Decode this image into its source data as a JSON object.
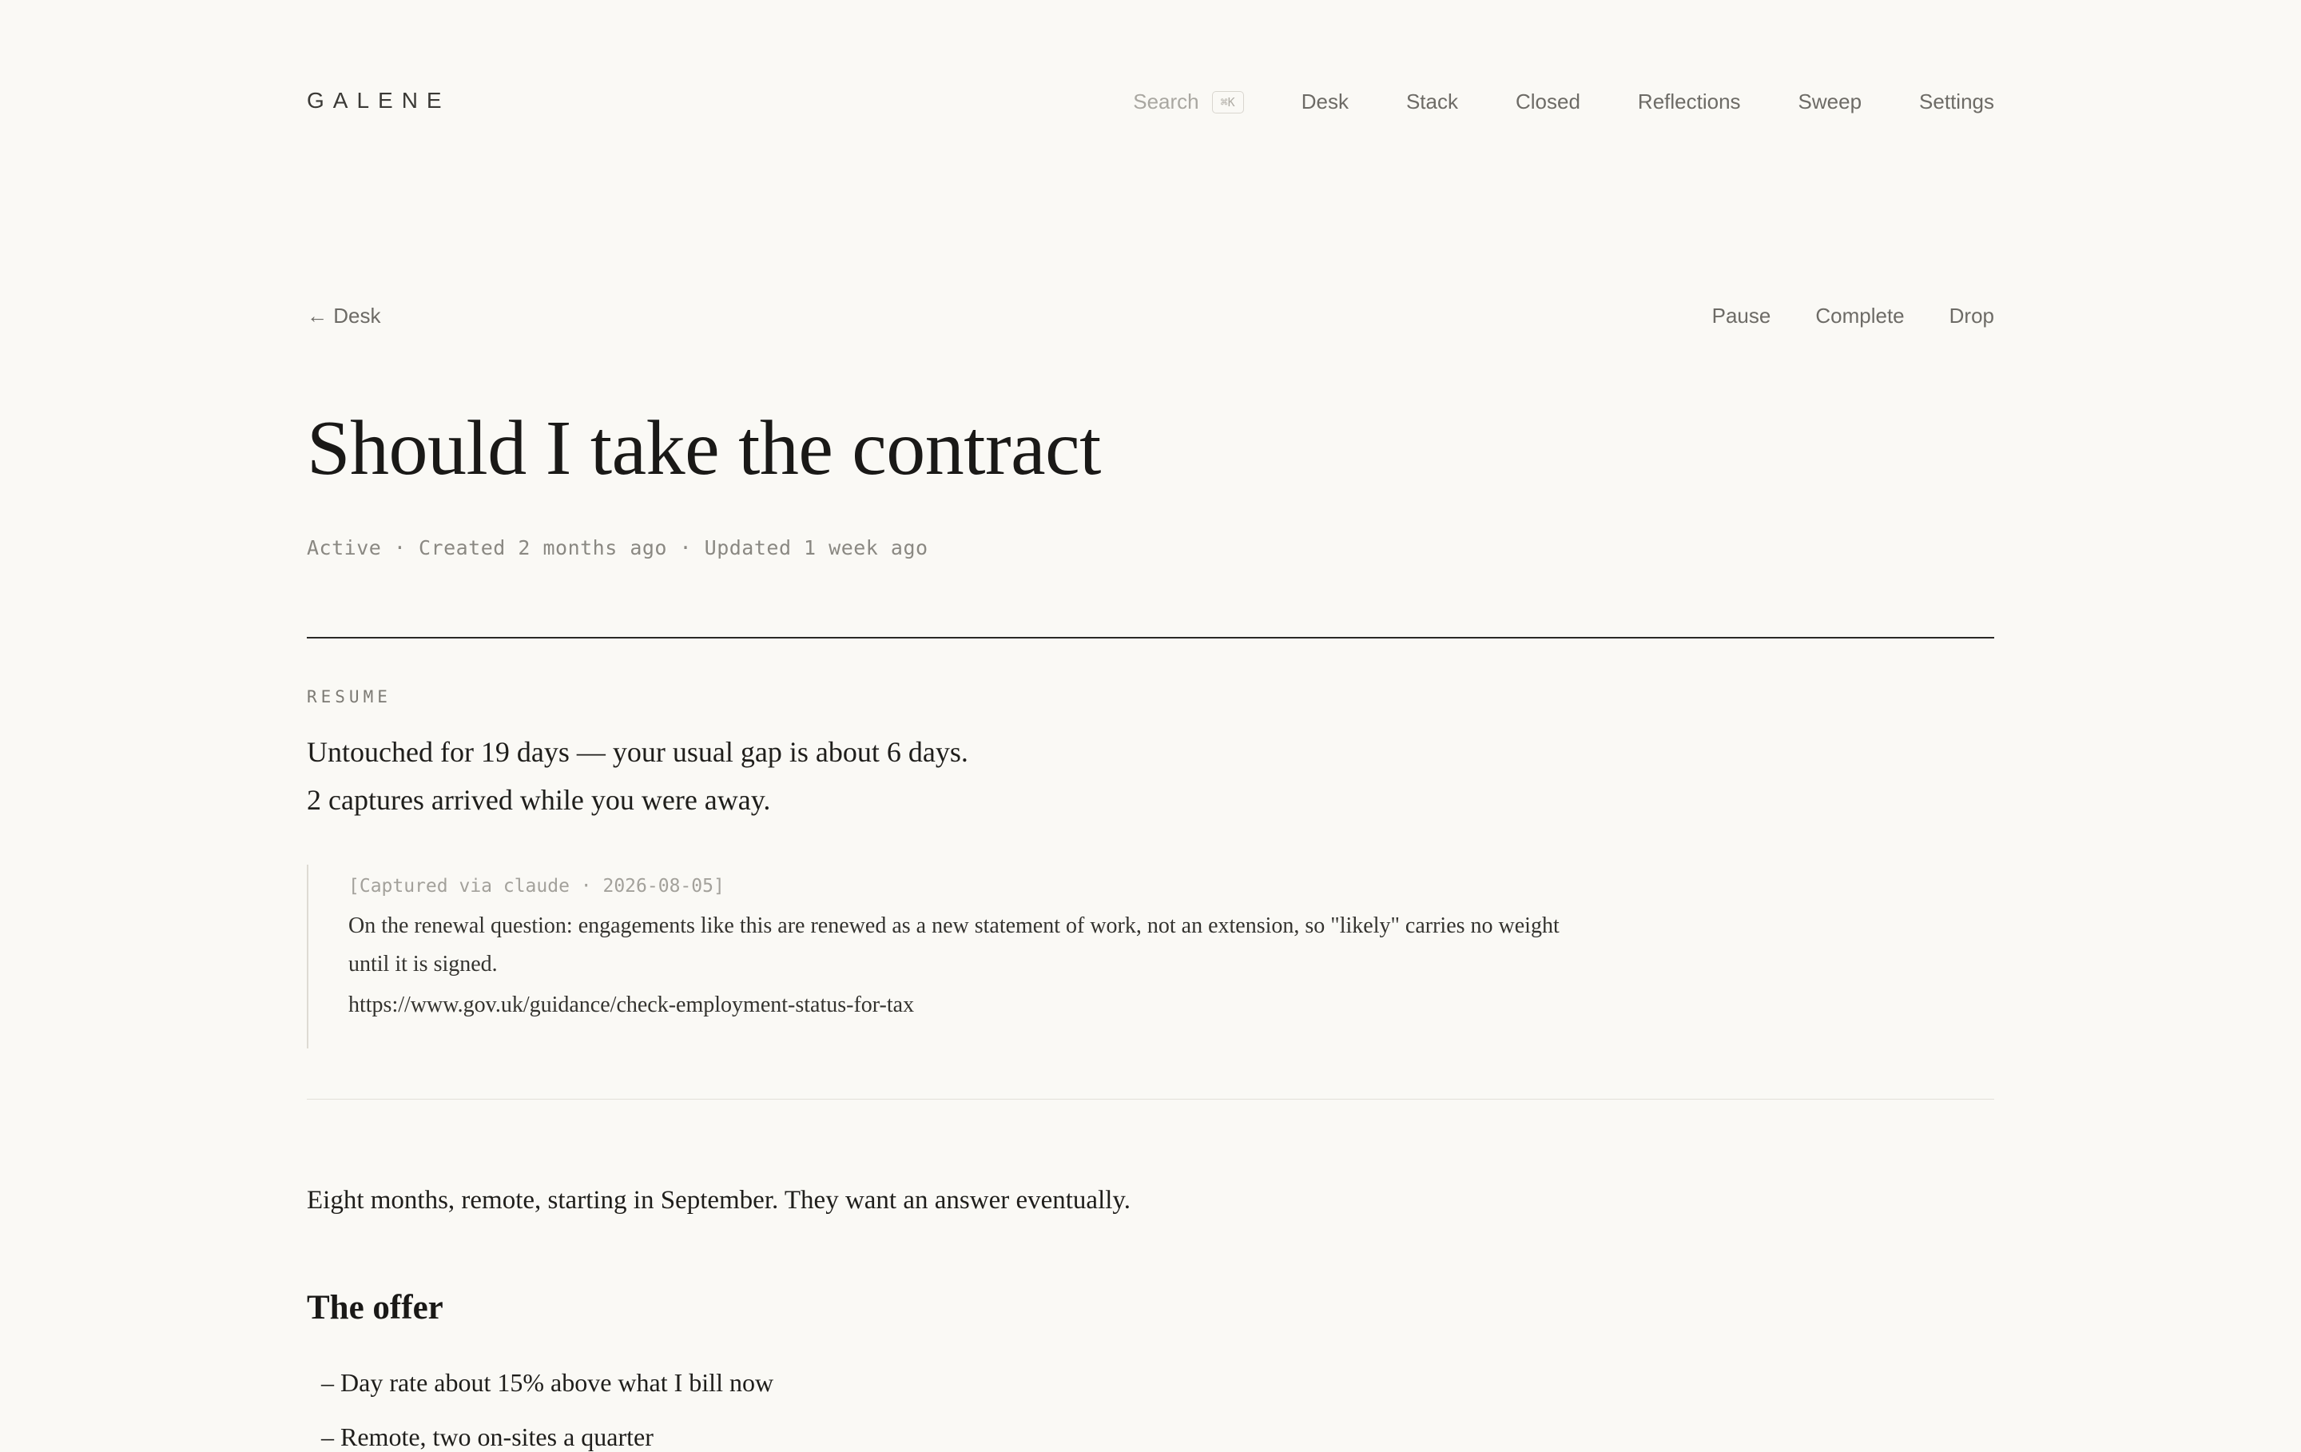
{
  "app": {
    "logo": "GALENE"
  },
  "nav": {
    "search_label": "Search",
    "search_shortcut": "⌘K",
    "items": [
      "Desk",
      "Stack",
      "Closed",
      "Reflections",
      "Sweep",
      "Settings"
    ]
  },
  "toolbar": {
    "back_label": "← Desk",
    "pause_label": "Pause",
    "complete_label": "Complete",
    "drop_label": "Drop"
  },
  "thread": {
    "title": "Should I take the contract",
    "meta": "Active · Created 2 months ago · Updated 1 week ago"
  },
  "resume": {
    "label": "RESUME",
    "line1": "Untouched for 19 days — your usual gap is about 6 days.",
    "line2": "2 captures arrived while you were away.",
    "capture": {
      "meta": "[Captured via claude · 2026-08-05]",
      "body": "On the renewal question: engagements like this are renewed as a new statement of work, not an extension, so \"likely\" carries no weight until it is signed.",
      "link": "https://www.gov.uk/guidance/check-employment-status-for-tax"
    }
  },
  "content": {
    "intro": "Eight months, remote, starting in September. They want an answer eventually.",
    "offer_heading": "The offer",
    "offer_items": [
      "– Day rate about 15% above what I bill now",
      "– Remote, two on-sites a quarter"
    ]
  }
}
